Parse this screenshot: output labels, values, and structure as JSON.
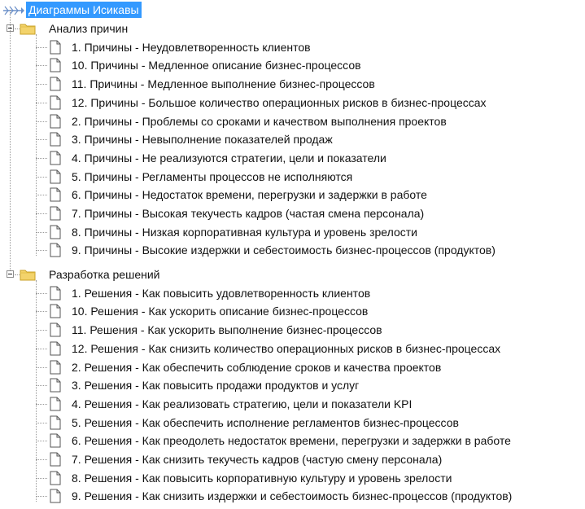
{
  "tree": {
    "root": {
      "label": "Диаграммы Исикавы",
      "icon": "fishbone-icon",
      "selected": true,
      "selection_color": "#3399ff"
    },
    "groups": [
      {
        "label": "Анализ причин",
        "icon": "folder-icon",
        "expanded": true,
        "items": [
          {
            "label": "1. Причины - Неудовлетворенность клиентов"
          },
          {
            "label": "10. Причины - Медленное описание бизнес-процессов"
          },
          {
            "label": "11. Причины - Медленное выполнение бизнес-процессов"
          },
          {
            "label": "12. Причины - Большое количество операционных рисков в бизнес-процессах"
          },
          {
            "label": "2. Причины - Проблемы со сроками и качеством выполнения проектов"
          },
          {
            "label": "3. Причины - Невыполнение показателей продаж"
          },
          {
            "label": "4. Причины - Не реализуются стратегии, цели и показатели"
          },
          {
            "label": "5. Причины - Регламенты процессов не исполняются"
          },
          {
            "label": "6. Причины - Недостаток времени, перегрузки и задержки в работе"
          },
          {
            "label": "7. Причины - Высокая текучесть кадров (частая смена персонала)"
          },
          {
            "label": "8. Причины - Низкая корпоративная культура и уровень зрелости"
          },
          {
            "label": "9. Причины - Высокие издержки и себестоимость бизнес-процессов (продуктов)"
          }
        ]
      },
      {
        "label": "Разработка решений",
        "icon": "folder-icon",
        "expanded": true,
        "items": [
          {
            "label": "1. Решения - Как повысить удовлетворенность клиентов"
          },
          {
            "label": "10. Решения - Как ускорить описание бизнес-процессов"
          },
          {
            "label": "11. Решения - Как ускорить выполнение бизнес-процессов"
          },
          {
            "label": "12. Решения - Как снизить количество операционных рисков в бизнес-процессах"
          },
          {
            "label": "2. Решения - Как обеспечить соблюдение сроков и качества проектов"
          },
          {
            "label": "3. Решения - Как повысить продажи продуктов и услуг"
          },
          {
            "label": "4. Решения - Как реализовать стратегию, цели и показатели KPI"
          },
          {
            "label": "5. Решения - Как обеспечить исполнение регламентов бизнес-процессов"
          },
          {
            "label": "6. Решения - Как преодолеть недостаток времени, перегрузки и задержки в работе"
          },
          {
            "label": "7. Решения - Как снизить текучесть кадров (частую смену персонала)"
          },
          {
            "label": "8. Решения - Как повысить корпоративную культуру и уровень зрелости"
          },
          {
            "label": "9. Решения - Как снизить издержки и себестоимость бизнес-процессов (продуктов)"
          }
        ]
      }
    ]
  }
}
